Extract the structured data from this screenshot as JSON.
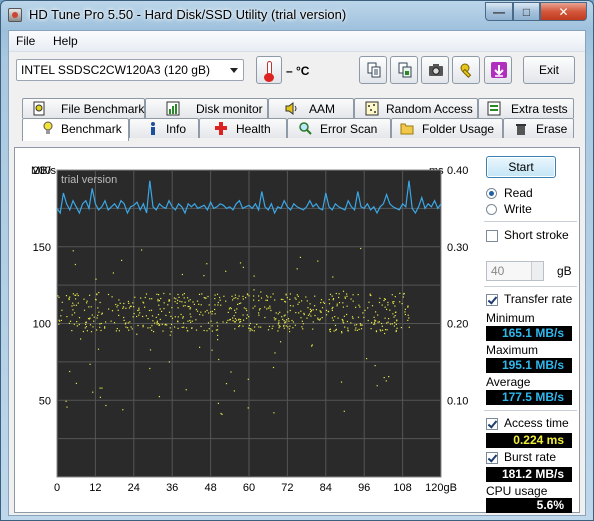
{
  "window": {
    "title": "HD Tune Pro 5.50 - Hard Disk/SSD Utility (trial version)"
  },
  "menu": {
    "file": "File",
    "help": "Help"
  },
  "toolbar": {
    "drive": "INTEL SSDSC2CW120A3 (120 gB)",
    "temperature": "– °C",
    "exit_label": "Exit",
    "buttons": [
      "copy-info",
      "copy-screenshot",
      "camera",
      "options",
      "download"
    ]
  },
  "tabs_top": [
    "File Benchmark",
    "Disk monitor",
    "AAM",
    "Random Access",
    "Extra tests"
  ],
  "tabs_bottom": [
    "Benchmark",
    "Info",
    "Health",
    "Error Scan",
    "Folder Usage",
    "Erase"
  ],
  "active_tab": "Benchmark",
  "side": {
    "start_label": "Start",
    "read_label": "Read",
    "write_label": "Write",
    "mode_selected": "Read",
    "short_stroke_label": "Short stroke",
    "short_stroke_checked": false,
    "short_stroke_value": "40",
    "short_stroke_unit": "gB",
    "transfer_rate_label": "Transfer rate",
    "transfer_rate_checked": true,
    "minimum_label": "Minimum",
    "minimum_value": "165.1 MB/s",
    "maximum_label": "Maximum",
    "maximum_value": "195.1 MB/s",
    "average_label": "Average",
    "average_value": "177.5 MB/s",
    "access_time_label": "Access time",
    "access_time_checked": true,
    "access_time_value": "0.224 ms",
    "burst_rate_label": "Burst rate",
    "burst_rate_checked": true,
    "burst_rate_value": "181.2 MB/s",
    "cpu_usage_label": "CPU usage",
    "cpu_usage_value": "5.6%"
  },
  "colors": {
    "plot_bg": "#2a2a2a",
    "transfer_line": "#3aa7e6",
    "access_dots": "#e8e84a",
    "grid": "#555555"
  },
  "chart_data": {
    "type": "line",
    "watermark": "trial version",
    "y_left_unit": "MB/s",
    "y_right_unit": "ms",
    "x_ticks": [
      "0",
      "12",
      "24",
      "36",
      "48",
      "60",
      "72",
      "84",
      "96",
      "108",
      "120gB"
    ],
    "y_left_ticks": [
      "200",
      "150",
      "100",
      "50"
    ],
    "y_right_ticks": [
      "0.40",
      "0.30",
      "0.20",
      "0.10"
    ],
    "xlim": [
      0,
      120
    ],
    "ylim_left": [
      0,
      200
    ],
    "ylim_right": [
      0,
      0.4
    ],
    "series": [
      {
        "kind": "transfer",
        "x": [
          0,
          1,
          2,
          3,
          4,
          5,
          6,
          7,
          8,
          9,
          10,
          11,
          12,
          13,
          14,
          15,
          16,
          17,
          18,
          19,
          20,
          21,
          22,
          23,
          24,
          25,
          26,
          27,
          28,
          29,
          30,
          31,
          32,
          33,
          34,
          35,
          36,
          37,
          38,
          39,
          40,
          41,
          42,
          43,
          44,
          45,
          46,
          47,
          48,
          49,
          50,
          51,
          52,
          53,
          54,
          55,
          56,
          57,
          58,
          59,
          60,
          61,
          62,
          63,
          64,
          65,
          66,
          67,
          68,
          69,
          70,
          71,
          72,
          73,
          74,
          75,
          76,
          77,
          78,
          79,
          80,
          81,
          82,
          83,
          84,
          85,
          86,
          87,
          88,
          89,
          90,
          91,
          92,
          93,
          94,
          95,
          96,
          97,
          98,
          99,
          100,
          101,
          102,
          103,
          104,
          105,
          106,
          107,
          108,
          109,
          110,
          111,
          112,
          113,
          114,
          115,
          116,
          117,
          118,
          119,
          120
        ],
        "values": [
          175,
          172,
          185,
          178,
          174,
          180,
          176,
          172,
          178,
          180,
          175,
          188,
          178,
          174,
          176,
          180,
          174,
          176,
          178,
          175,
          180,
          178,
          172,
          176,
          177,
          179,
          174,
          178,
          172,
          193,
          176,
          174,
          178,
          176,
          175,
          180,
          176,
          174,
          178,
          176,
          172,
          178,
          176,
          178,
          175,
          176,
          177,
          174,
          179,
          175,
          176,
          178,
          177,
          175,
          176,
          174,
          178,
          180,
          175,
          176,
          177,
          175,
          178,
          174,
          186,
          176,
          174,
          178,
          172,
          176,
          175,
          180,
          176,
          174,
          178,
          176,
          175,
          174,
          176,
          180,
          176,
          178,
          175,
          174,
          185,
          176,
          174,
          178,
          176,
          175,
          174,
          180,
          176,
          174,
          186,
          176,
          175,
          178,
          174,
          176,
          172,
          176,
          178,
          184,
          178,
          176,
          175,
          174,
          178,
          176,
          193,
          175,
          172,
          176,
          182,
          175,
          178,
          176,
          180,
          175,
          178
        ]
      },
      {
        "kind": "access_time_dots",
        "unit": "ms",
        "count": 700,
        "typical_range": [
          0.19,
          0.24
        ],
        "outliers_range": [
          0.08,
          0.3
        ]
      }
    ]
  }
}
